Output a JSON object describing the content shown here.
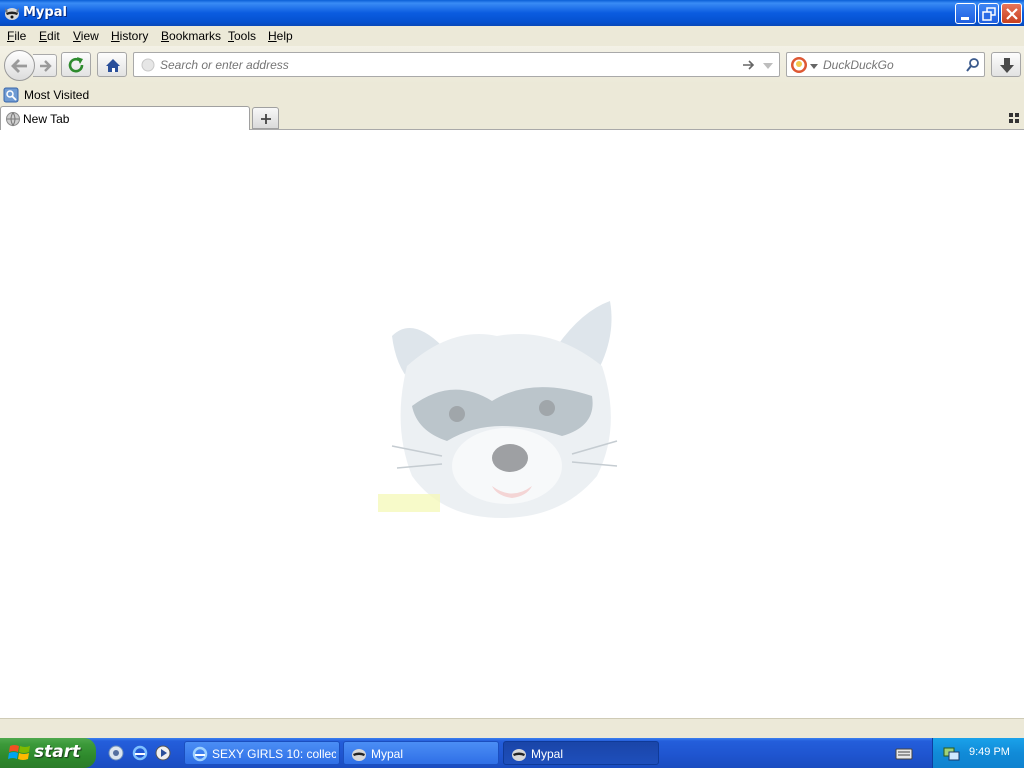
{
  "window": {
    "title": "Mypal"
  },
  "menubar": {
    "items": [
      {
        "label": "File",
        "accel": "F",
        "rest": "ile"
      },
      {
        "label": "Edit",
        "accel": "E",
        "rest": "dit"
      },
      {
        "label": "View",
        "accel": "V",
        "rest": "iew"
      },
      {
        "label": "History",
        "accel": "H",
        "rest": "istory"
      },
      {
        "label": "Bookmarks",
        "accel": "B",
        "rest": "ookmarks"
      },
      {
        "label": "Tools",
        "accel": "T",
        "rest": "ools"
      },
      {
        "label": "Help",
        "accel": "H",
        "rest": "elp"
      }
    ]
  },
  "navbar": {
    "url_placeholder": "Search or enter address",
    "search_placeholder": "DuckDuckGo"
  },
  "bookmarks": {
    "items": [
      {
        "label": "Most Visited"
      }
    ]
  },
  "tabs": [
    {
      "label": "New Tab",
      "active": true
    }
  ],
  "taskbar": {
    "start_label": "start",
    "tasks": [
      {
        "label": "SEXY GIRLS 10: collec...",
        "icon": "ie-icon",
        "active": false
      },
      {
        "label": "Mypal",
        "icon": "mypal-icon",
        "active": false
      },
      {
        "label": "Mypal",
        "icon": "mypal-icon",
        "active": true
      }
    ],
    "clock": "9:49 PM"
  },
  "colors": {
    "titlebar": "#0b5ce0",
    "taskbar": "#245edb",
    "start": "#3c9a3a",
    "chrome": "#ece9d8"
  }
}
